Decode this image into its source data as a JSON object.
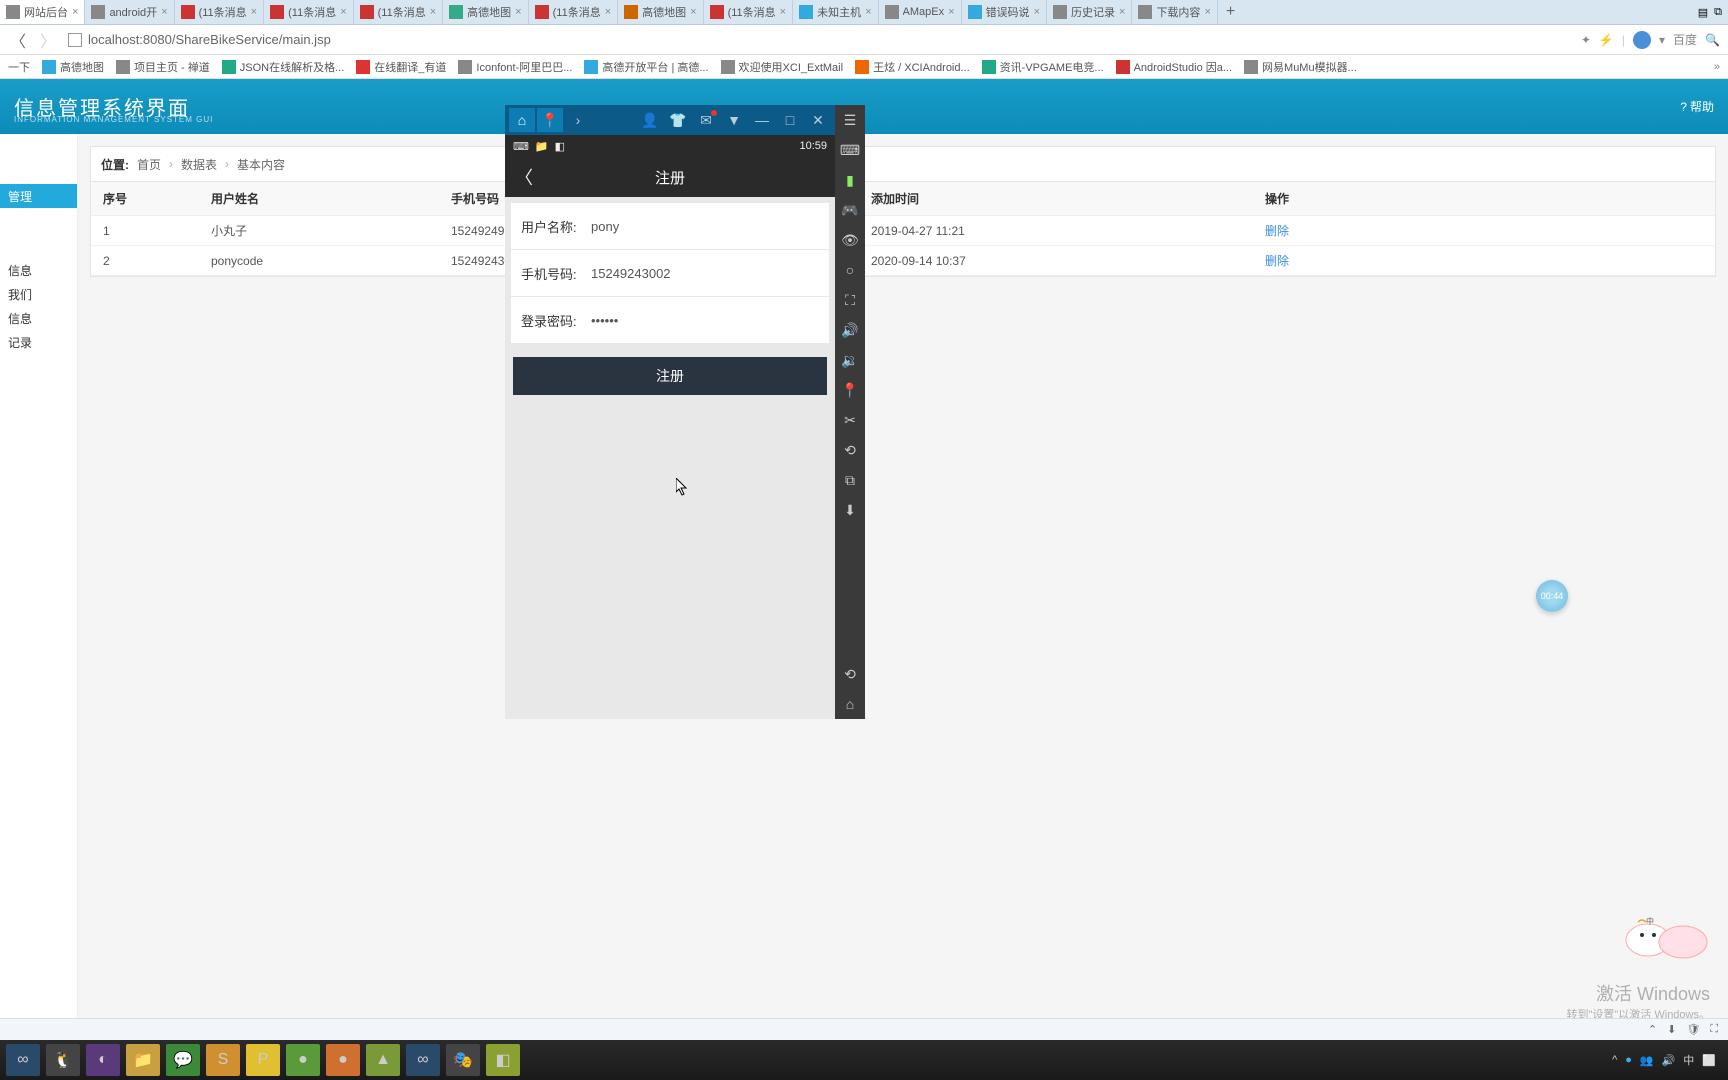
{
  "browser": {
    "tabs": [
      {
        "label": "网站后台"
      },
      {
        "label": "android开"
      },
      {
        "label": "(11条消息"
      },
      {
        "label": "(11条消息"
      },
      {
        "label": "(11条消息"
      },
      {
        "label": "高德地图"
      },
      {
        "label": "(11条消息"
      },
      {
        "label": "高德地图"
      },
      {
        "label": "(11条消息"
      },
      {
        "label": "未知主机"
      },
      {
        "label": "AMapEx"
      },
      {
        "label": "错误码说"
      },
      {
        "label": "历史记录"
      },
      {
        "label": "下载内容"
      }
    ],
    "url": "localhost:8080/ShareBikeService/main.jsp",
    "search_hint": "百度"
  },
  "bookmarks": [
    "一下",
    "高德地图",
    "项目主页 - 禅道",
    "JSON在线解析及格...",
    "在线翻译_有道",
    "Iconfont-阿里巴巴...",
    "高德开放平台 | 高德...",
    "欢迎使用XCI_ExtMail",
    "王炫 / XCIAndroid...",
    "资讯-VPGAME电竞...",
    "AndroidStudio 因a...",
    "网易MuMu模拟器..."
  ],
  "app": {
    "title": "信息管理系统界面",
    "subtitle": "INFORMATION MANAGEMENT SYSTEM GUI",
    "help": "帮助"
  },
  "sidebar": {
    "items": [
      "管理",
      "信息",
      "我们",
      "信息",
      "记录"
    ]
  },
  "breadcrumb": {
    "label": "位置:",
    "items": [
      "首页",
      "数据表",
      "基本内容"
    ]
  },
  "table": {
    "headers": {
      "idx": "序号",
      "name": "用户姓名",
      "phone": "手机号码",
      "time": "添加时间",
      "op": "操作"
    },
    "rows": [
      {
        "idx": "1",
        "name": "小丸子",
        "phone": "15249249695",
        "time": "2019-04-27 11:21",
        "op": "删除"
      },
      {
        "idx": "2",
        "name": "ponycode",
        "phone": "15249243002",
        "time": "2020-09-14 10:37",
        "op": "删除"
      }
    ]
  },
  "emulator": {
    "status_time": "10:59",
    "screen_title": "注册",
    "form": {
      "username_label": "用户名称:",
      "username_val": "pony",
      "phone_label": "手机号码:",
      "phone_val": "15249243002",
      "password_label": "登录密码:",
      "password_val": "••••••"
    },
    "register_btn": "注册"
  },
  "float_timer": "00:44",
  "activate": {
    "line1": "激活 Windows",
    "line2": "转到\"设置\"以激活 Windows。"
  },
  "info_bar": {
    "ime": "中"
  }
}
